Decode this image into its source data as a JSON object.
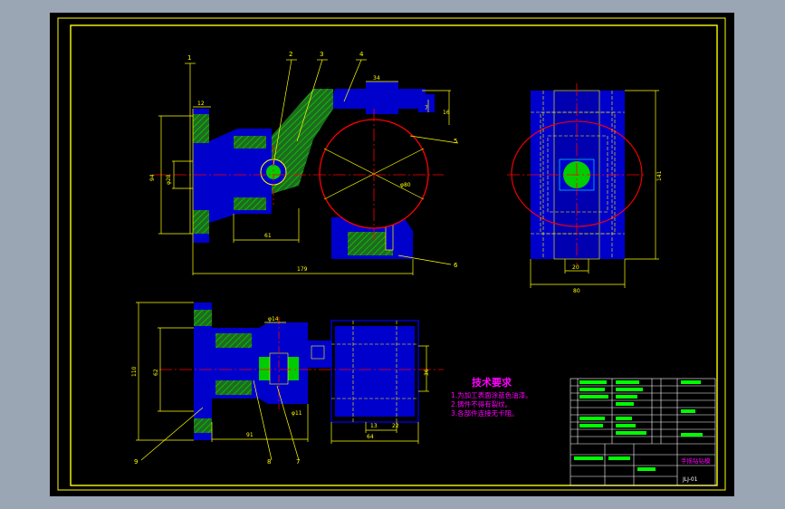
{
  "colors": {
    "window_bg": "#9aa6b4",
    "paper": "#000000",
    "frame": "#ffff00",
    "part_fill": "#0000cc",
    "hatch": "#00cc00",
    "dim": "#ffff00",
    "center": "#ff0000",
    "hidden": "#ffff00",
    "magenta": "#ff00ff",
    "cyan": "#00ffff",
    "white": "#ffffff"
  },
  "front_view": {
    "balloons": [
      "1",
      "2",
      "3",
      "4",
      "5",
      "6"
    ],
    "dims": {
      "d12": "12",
      "d34": "34",
      "d7": "7",
      "d16": "16",
      "d94": "94",
      "phi28": "φ28",
      "phi80": "φ80",
      "d61": "61",
      "d179": "179"
    }
  },
  "side_view": {
    "dims": {
      "d141": "141",
      "d20": "20",
      "d80": "80"
    }
  },
  "top_view": {
    "balloons": [
      "9",
      "8",
      "7"
    ],
    "dims": {
      "d110": "110",
      "d62": "62",
      "phi14": "φ14",
      "phi11": "φ11",
      "d91": "91",
      "d36": "36",
      "d13": "13",
      "d22": "22",
      "d64": "64"
    }
  },
  "tech": {
    "title": "技术要求",
    "lines": [
      "1.为加工表面涂蓝色油漆。",
      "2.铸件不得有裂纹。",
      "3.各部件连接无卡阻。"
    ]
  },
  "title_block": {
    "name": "手摇钻钻模",
    "drawing_no": "JLJ-01"
  }
}
